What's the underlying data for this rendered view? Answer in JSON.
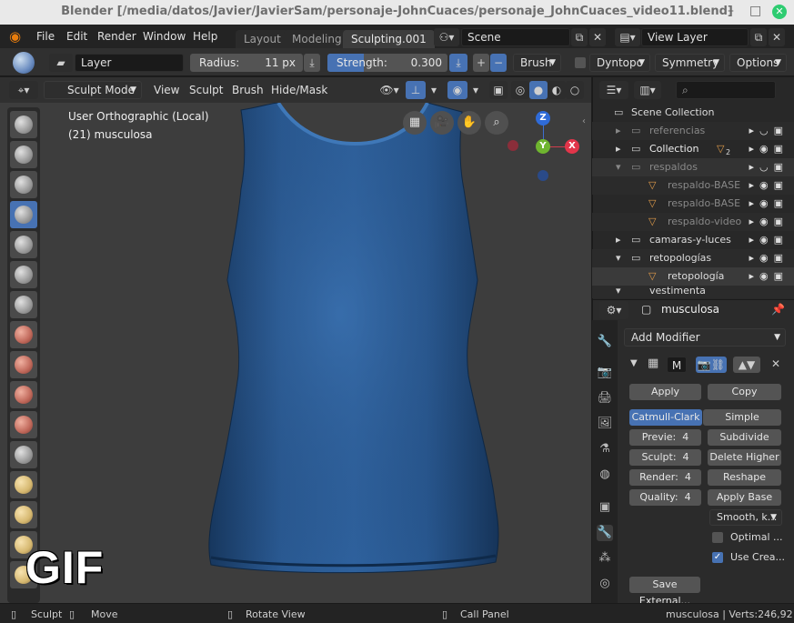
{
  "window": {
    "title": "Blender [/media/datos/Javier/JavierSam/personaje-JohnCuaces/personaje_JohnCuaces_video11.blend]",
    "minimize": "–",
    "maximize": "□",
    "close": "✕"
  },
  "menubar": {
    "items": [
      "File",
      "Edit",
      "Render",
      "Window",
      "Help"
    ],
    "workspaces": [
      "Layout",
      "Modeling",
      "Sculpting.001"
    ],
    "scene": "Scene",
    "view_layer": "View Layer"
  },
  "tool_header": {
    "layer": "Layer",
    "radius_label": "Radius:",
    "radius_value": "11 px",
    "strength_label": "Strength:",
    "strength_value": "0.300",
    "plus": "+",
    "minus": "−",
    "brush": "Brush",
    "dyntopo": "Dyntopo",
    "symmetry": "Symmetry",
    "options": "Options"
  },
  "viewport_header": {
    "mode": "Sculpt Mode",
    "menus": [
      "View",
      "Sculpt",
      "Brush",
      "Hide/Mask"
    ]
  },
  "viewport": {
    "view_name": "User Orthographic (Local)",
    "object_info": "(21) musculosa",
    "overlay_tag": "GIF",
    "axes": {
      "z": "Z",
      "y": "Y",
      "x": "X"
    }
  },
  "outliner": {
    "search_placeholder": "",
    "rows": [
      {
        "name": "Scene Collection",
        "dim": false
      },
      {
        "name": "referencias",
        "dim": true
      },
      {
        "name": "Collection",
        "dim": false
      },
      {
        "name": "respaldos",
        "dim": true
      },
      {
        "name": "respaldo-BASE",
        "dim": true
      },
      {
        "name": "respaldo-BASE",
        "dim": true
      },
      {
        "name": "respaldo-video",
        "dim": true
      },
      {
        "name": "camaras-y-luces",
        "dim": false
      },
      {
        "name": "retopologías",
        "dim": false
      },
      {
        "name": "retopología",
        "dim": false
      },
      {
        "name": "vestimenta",
        "dim": false
      }
    ],
    "collection_badge": "2"
  },
  "properties": {
    "object_name": "musculosa",
    "add_modifier": "Add Modifier",
    "modifier_tag": "M",
    "apply": "Apply",
    "copy": "Copy",
    "catmull_clark": "Catmull-Clark",
    "simple": "Simple",
    "preview": "Previe:",
    "preview_val": "4",
    "sculpt": "Sculpt:",
    "sculpt_val": "4",
    "render": "Render:",
    "render_val": "4",
    "quality": "Quality:",
    "quality_val": "4",
    "subdivide": "Subdivide",
    "delete_higher": "Delete Higher",
    "reshape": "Reshape",
    "apply_base": "Apply Base",
    "smooth": "Smooth, k...",
    "optimal": "Optimal ...",
    "use_crease": "Use Crea...",
    "save_external": "Save External..."
  },
  "statusbar": {
    "sculpt": "Sculpt",
    "move": "Move",
    "rotate": "Rotate View",
    "call_panel": "Call Panel",
    "info": "musculosa | Verts:246,92"
  }
}
